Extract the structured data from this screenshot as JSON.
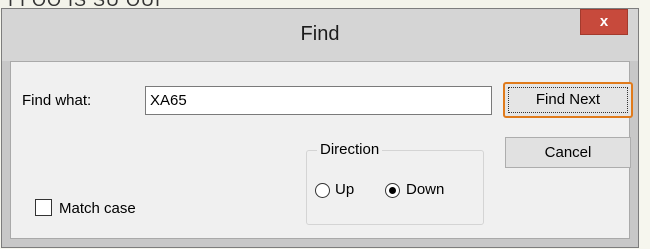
{
  "background": {
    "partial_text": "I I OO IS SU OUI"
  },
  "dialog": {
    "title": "Find",
    "close_label": "x",
    "find_what_label": "Find what:",
    "find_what_value": "XA65",
    "find_next_label": "Find Next",
    "cancel_label": "Cancel",
    "direction_label": "Direction",
    "up_label": "Up",
    "down_label": "Down",
    "direction_selected": "Down",
    "match_case_label": "Match case",
    "match_case_checked": false
  },
  "colors": {
    "close_button": "#c74a3c",
    "focus_outline": "#e07b1c",
    "title_bar": "#d5d5d5"
  }
}
